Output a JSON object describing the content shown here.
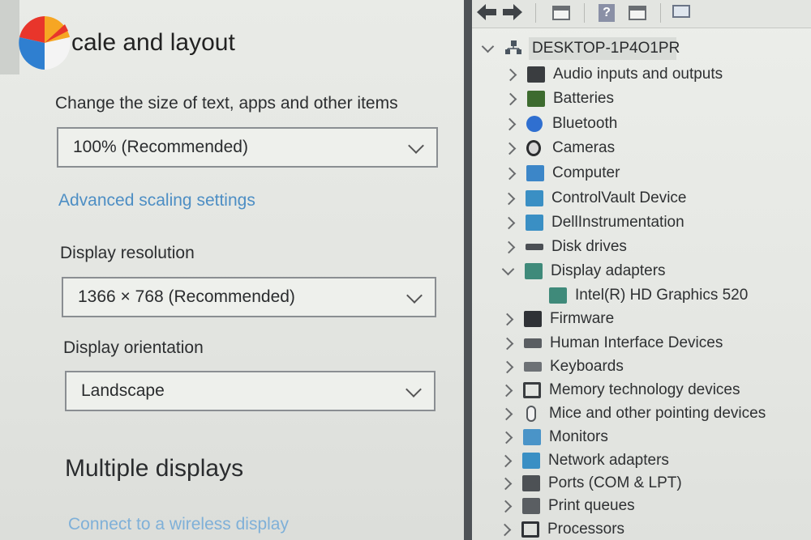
{
  "settings": {
    "section_title": "cale and layout",
    "scale_label": "Change the size of text, apps and other items",
    "scale_value": "100% (Recommended)",
    "advanced_link": "Advanced scaling settings",
    "resolution_label": "Display resolution",
    "resolution_value": "1366 × 768 (Recommended)",
    "orientation_label": "Display orientation",
    "orientation_value": "Landscape",
    "multiple_title": "Multiple displays",
    "wireless_link": "Connect to a wireless display"
  },
  "device_manager": {
    "root": "DESKTOP-1P4O1PR",
    "categories": [
      {
        "label": "Audio inputs and outputs",
        "icon": "speaker-icon",
        "expanded": false
      },
      {
        "label": "Batteries",
        "icon": "battery-icon",
        "expanded": false
      },
      {
        "label": "Bluetooth",
        "icon": "bluetooth-icon",
        "expanded": false
      },
      {
        "label": "Cameras",
        "icon": "camera-icon",
        "expanded": false
      },
      {
        "label": "Computer",
        "icon": "computer-icon",
        "expanded": false
      },
      {
        "label": "ControlVault Device",
        "icon": "network-monitor-icon",
        "expanded": false
      },
      {
        "label": "DellInstrumentation",
        "icon": "network-monitor-icon",
        "expanded": false
      },
      {
        "label": "Disk drives",
        "icon": "disk-icon",
        "expanded": false
      },
      {
        "label": "Display adapters",
        "icon": "display-adapter-icon",
        "expanded": true
      },
      {
        "label": "Intel(R) HD Graphics 520",
        "icon": "display-adapter-icon",
        "child": true
      },
      {
        "label": "Firmware",
        "icon": "chip-icon",
        "expanded": false
      },
      {
        "label": "Human Interface Devices",
        "icon": "hid-icon",
        "expanded": false
      },
      {
        "label": "Keyboards",
        "icon": "keyboard-icon",
        "expanded": false
      },
      {
        "label": "Memory technology devices",
        "icon": "memory-icon",
        "expanded": false
      },
      {
        "label": "Mice and other pointing devices",
        "icon": "mouse-icon",
        "expanded": false
      },
      {
        "label": "Monitors",
        "icon": "monitor-icon",
        "expanded": false
      },
      {
        "label": "Network adapters",
        "icon": "network-monitor-icon",
        "expanded": false
      },
      {
        "label": "Ports (COM & LPT)",
        "icon": "port-icon",
        "expanded": false
      },
      {
        "label": "Print queues",
        "icon": "printer-icon",
        "expanded": false
      },
      {
        "label": "Processors",
        "icon": "processor-icon",
        "expanded": false
      }
    ]
  },
  "colors": {
    "link": "#4d8ec4",
    "divider": "#4e5256"
  }
}
